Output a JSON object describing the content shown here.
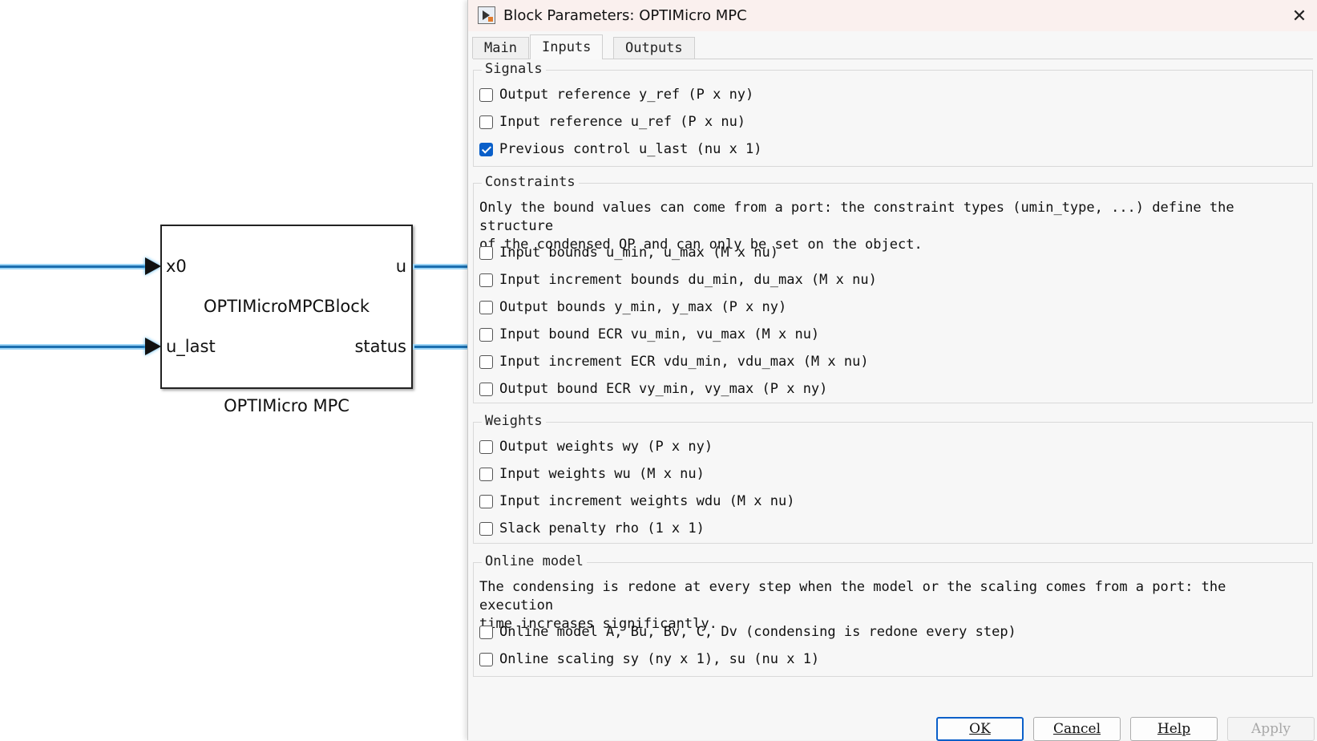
{
  "canvas": {
    "block_name": "OPTIMicroMPCBlock",
    "block_caption": "OPTIMicro MPC",
    "ports": {
      "in1": "x0",
      "in2": "u_last",
      "out1": "u",
      "out2": "status"
    }
  },
  "dialog": {
    "title": "Block Parameters: OPTIMicro MPC",
    "close_glyph": "✕",
    "tabs": [
      "Main",
      "Inputs",
      "Outputs"
    ],
    "active_tab": "Inputs",
    "signals": {
      "title": "Signals",
      "items": [
        {
          "label": "Output reference y_ref (P x ny)",
          "checked": false
        },
        {
          "label": "Input reference u_ref (P x nu)",
          "checked": false
        },
        {
          "label": "Previous control u_last (nu x 1)",
          "checked": true
        }
      ]
    },
    "constraints": {
      "title": "Constraints",
      "description": "Only the bound values can come from a port: the constraint types (umin_type, ...) define the structure\nof the condensed QP and can only be set on the object.",
      "items": [
        {
          "label": "Input bounds u_min, u_max (M x nu)",
          "checked": false
        },
        {
          "label": "Input increment bounds du_min, du_max (M x nu)",
          "checked": false
        },
        {
          "label": "Output bounds y_min, y_max (P x ny)",
          "checked": false
        },
        {
          "label": "Input bound ECR vu_min, vu_max (M x nu)",
          "checked": false
        },
        {
          "label": "Input increment ECR vdu_min, vdu_max (M x nu)",
          "checked": false
        },
        {
          "label": "Output bound ECR vy_min, vy_max (P x ny)",
          "checked": false
        }
      ]
    },
    "weights": {
      "title": "Weights",
      "items": [
        {
          "label": "Output weights wy (P x ny)",
          "checked": false
        },
        {
          "label": "Input weights wu (M x nu)",
          "checked": false
        },
        {
          "label": "Input increment weights wdu (M x nu)",
          "checked": false
        },
        {
          "label": "Slack penalty rho (1 x 1)",
          "checked": false
        }
      ]
    },
    "online_model": {
      "title": "Online model",
      "description": "The condensing is redone at every step when the model or the scaling comes from a port: the execution\ntime increases significantly.",
      "items": [
        {
          "label": "Online model A, Bu, Bv, C, Dv (condensing is redone every step)",
          "checked": false
        },
        {
          "label": "Online scaling sy (ny x 1), su (nu x 1)",
          "checked": false
        }
      ]
    },
    "buttons": {
      "ok": "OK",
      "cancel": "Cancel",
      "help": "Help",
      "apply": "Apply"
    }
  },
  "colors": {
    "checked_accent": "#0a5fc9",
    "signal_line": "#1b6fb0",
    "signal_glow": "#9fd6f7"
  }
}
